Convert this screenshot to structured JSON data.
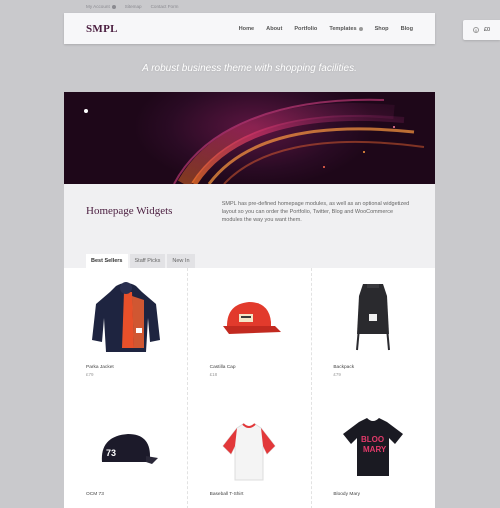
{
  "util_links": [
    "My Account",
    "Sitemap",
    "Contact Form"
  ],
  "logo": "SMPL",
  "nav": [
    "Home",
    "About",
    "Portfolio",
    "Templates",
    "Shop",
    "Blog"
  ],
  "cart": {
    "count": "0",
    "total": "£0"
  },
  "tagline": "A robust business theme with shopping facilities.",
  "intro": {
    "title": "Homepage Widgets",
    "text": "SMPL has pre-defined homepage modules, as well as an optional widgetized layout so you can order the Portfolio, Twitter, Blog and WooCommerce modules the way you want them."
  },
  "tabs": [
    "Best Sellers",
    "Staff Picks",
    "New In"
  ],
  "products": [
    {
      "name": "Parka Jacket",
      "price": "£79",
      "icon": "parka-jacket-image"
    },
    {
      "name": "Castilla Cap",
      "price": "£18",
      "icon": "cap-image"
    },
    {
      "name": "Backpack",
      "price": "£79",
      "icon": "backpack-image"
    },
    {
      "name": "OCM 73",
      "price": "",
      "icon": "cap-73-image"
    },
    {
      "name": "Baseball T-Shirt",
      "price": "",
      "icon": "baseball-tshirt-image"
    },
    {
      "name": "Bloody Mary",
      "price": "",
      "icon": "tshirt-image"
    }
  ],
  "colors": {
    "brand": "#4a1d3f",
    "background": "#c9c9cc",
    "hero": "#2a0b24",
    "accent": "#e23a2c"
  }
}
